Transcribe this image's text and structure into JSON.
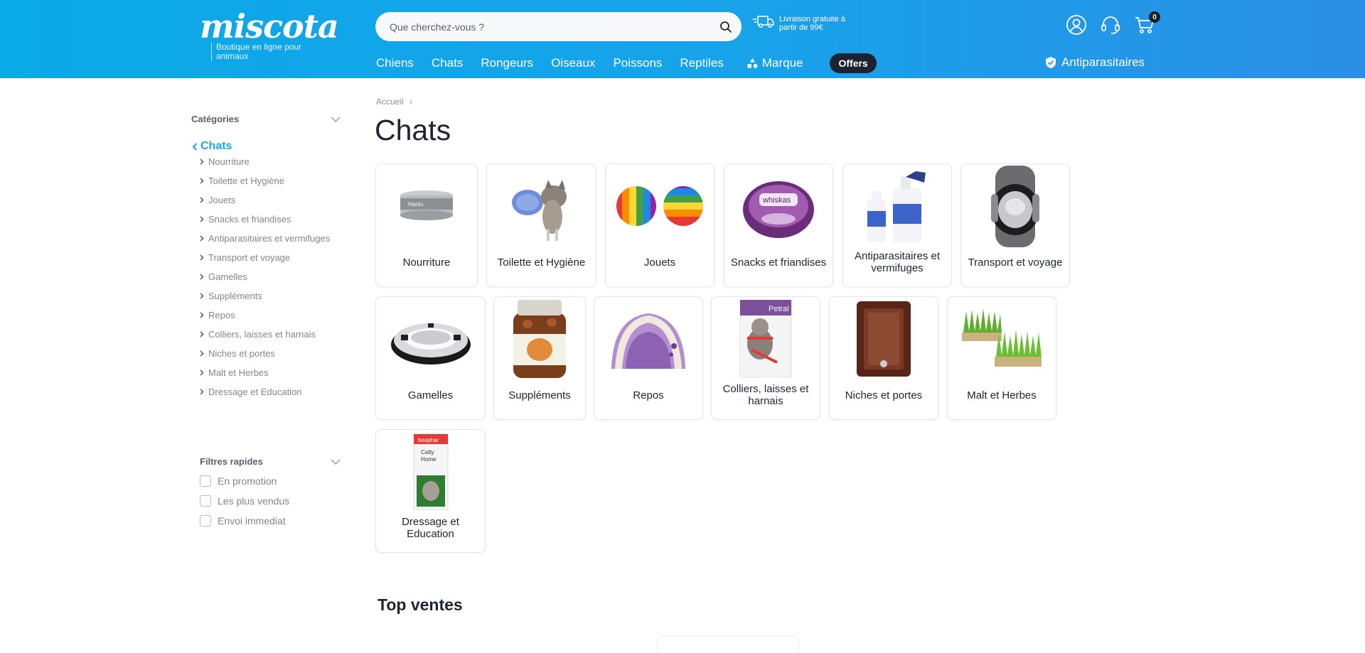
{
  "header": {
    "logo_text": "miscota",
    "logo_tagline": "Boutique en ligne pour animaux",
    "search_placeholder": "Que cherchez-vous ?",
    "delivery_text": "Livraison gratuite à partir de 99€",
    "cart_count": "0",
    "background_color": "#0aa9e8"
  },
  "nav": {
    "items": [
      "Chiens",
      "Chats",
      "Rongeurs",
      "Oiseaux",
      "Poissons",
      "Reptiles"
    ],
    "brand_label": "Marque",
    "offers_label": "Offers",
    "antiparasitaires_label": "Antiparasitaires"
  },
  "breadcrumb": {
    "home": "Accueil"
  },
  "page_title": "Chats",
  "sidebar": {
    "categories_heading": "Catégories",
    "current_category": "Chats",
    "items": [
      "Nourriture",
      "Toilette et Hygiène",
      "Jouets",
      "Snacks et friandises",
      "Antiparasitaires et vermifuges",
      "Transport et voyage",
      "Gamelles",
      "Suppléments",
      "Repos",
      "Colliers, laisses et harnais",
      "Niches et portes",
      "Malt et Herbes",
      "Dressage et Education"
    ],
    "filters_heading": "Filtres rapides",
    "filters": [
      "En promotion",
      "Les plus vendus",
      "Envoi immediat"
    ]
  },
  "categories": [
    {
      "label": "Nourriture",
      "icon": "cat-food-tin-icon"
    },
    {
      "label": "Toilette et Hygiène",
      "icon": "grooming-glove-icon"
    },
    {
      "label": "Jouets",
      "icon": "rainbow-balls-icon"
    },
    {
      "label": "Snacks et friandises",
      "icon": "treats-pack-icon"
    },
    {
      "label": "Antiparasitaires et vermifuges",
      "icon": "spray-bottles-icon"
    },
    {
      "label": "Transport et voyage",
      "icon": "pet-carrier-icon"
    },
    {
      "label": "Gamelles",
      "icon": "steel-bowl-icon"
    },
    {
      "label": "Suppléments",
      "icon": "supplement-jar-icon"
    },
    {
      "label": "Repos",
      "icon": "cat-bed-icon"
    },
    {
      "label": "Colliers, laisses et harnais",
      "icon": "harness-pack-icon"
    },
    {
      "label": "Niches et portes",
      "icon": "cat-flap-icon"
    },
    {
      "label": "Malt et Herbes",
      "icon": "cat-grass-icon"
    },
    {
      "label": "Dressage et Education",
      "icon": "training-spray-icon"
    }
  ],
  "top_sales_heading": "Top ventes"
}
